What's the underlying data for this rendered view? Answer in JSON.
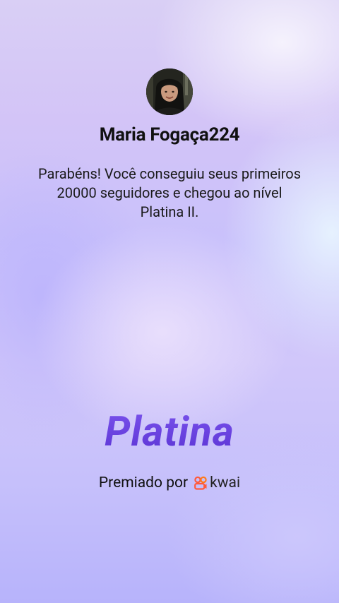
{
  "profile": {
    "username": "Maria Fogaça224",
    "avatar_icon": "user-photo-avatar"
  },
  "achievement": {
    "message": "Parabéns! Você conseguiu seus primeiros 20000 seguidores e chegou ao nível Platina II.",
    "tier_name": "Platina"
  },
  "footer": {
    "awarded_by": "Premiado por",
    "brand_name": "kwai",
    "brand_icon": "kwai-logo-icon",
    "brand_color": "#ff5a3c"
  },
  "colors": {
    "tier_text": "#6a3fe0",
    "background_top": "#d9cff5",
    "background_bottom": "#b7b3fb"
  }
}
